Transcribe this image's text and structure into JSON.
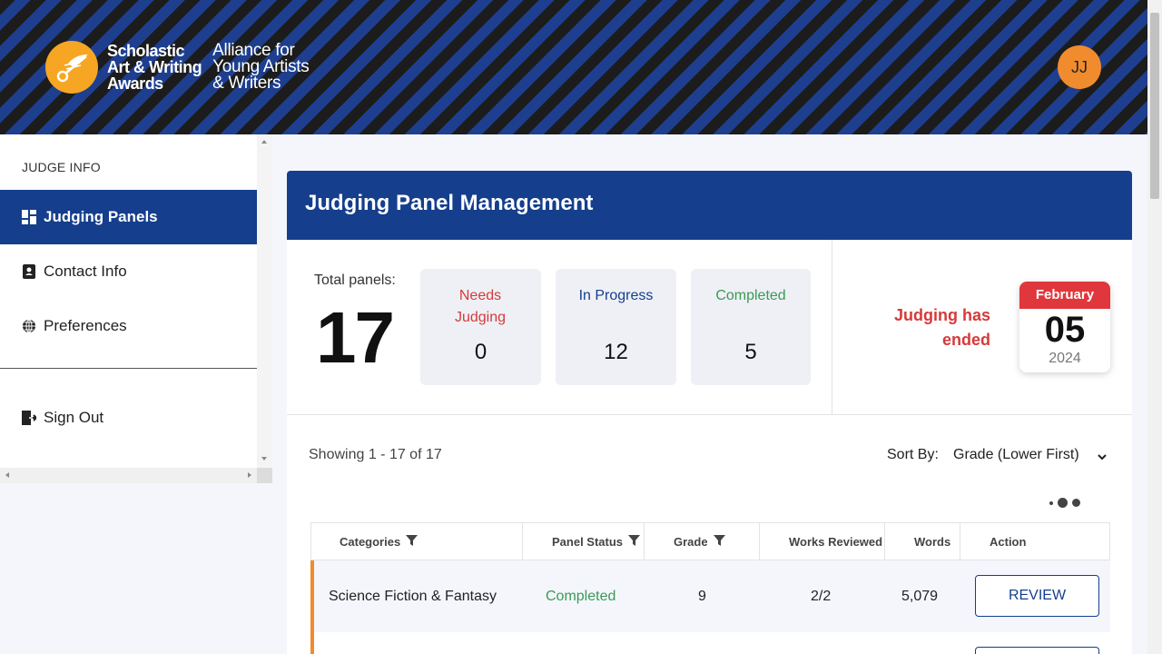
{
  "header": {
    "logo_main": [
      "Scholastic",
      "Art & Writing",
      "Awards"
    ],
    "logo_sub": [
      "Alliance for",
      "Young Artists",
      "& Writers"
    ],
    "avatar_initials": "JJ",
    "colors": {
      "stripe_dark": "#1c1c1c",
      "stripe_blue": "#1e3f8f",
      "logo": "#f6a623",
      "avatar": "#f08c2e"
    }
  },
  "sidebar": {
    "heading": "JUDGE INFO",
    "items": [
      {
        "label": "Judging Panels",
        "icon": "dashboard-icon",
        "active": true
      },
      {
        "label": "Contact Info",
        "icon": "contact-book-icon",
        "active": false
      },
      {
        "label": "Preferences",
        "icon": "globe-icon",
        "active": false
      }
    ],
    "sign_out": {
      "label": "Sign Out",
      "icon": "sign-out-icon"
    }
  },
  "main": {
    "title": "Judging Panel Management",
    "total_label": "Total panels:",
    "total_value": "17",
    "stats": [
      {
        "label": "Needs Judging",
        "value": "0",
        "color": "#d63a3a"
      },
      {
        "label": "In Progress",
        "value": "12",
        "color": "#153e8c"
      },
      {
        "label": "Completed",
        "value": "5",
        "color": "#3a9a56"
      }
    ],
    "status_message": "Judging has ended",
    "calendar": {
      "month": "February",
      "day": "05",
      "year": "2024"
    },
    "showing": "Showing 1 - 17 of 17",
    "sort": {
      "label": "Sort By:",
      "value": "Grade (Lower First)"
    }
  },
  "table": {
    "columns": [
      "Categories",
      "Panel Status",
      "Grade",
      "Works Reviewed",
      "Words",
      "Action"
    ],
    "rows": [
      {
        "category": "Science Fiction & Fantasy",
        "status": "Completed",
        "grade": "9",
        "works_reviewed": "2/2",
        "words": "5,079",
        "action": "REVIEW"
      }
    ]
  },
  "colors": {
    "primary": "#153e8c",
    "completed": "#3a9a56",
    "alert": "#d63a3a",
    "accent": "#f08c2e"
  }
}
